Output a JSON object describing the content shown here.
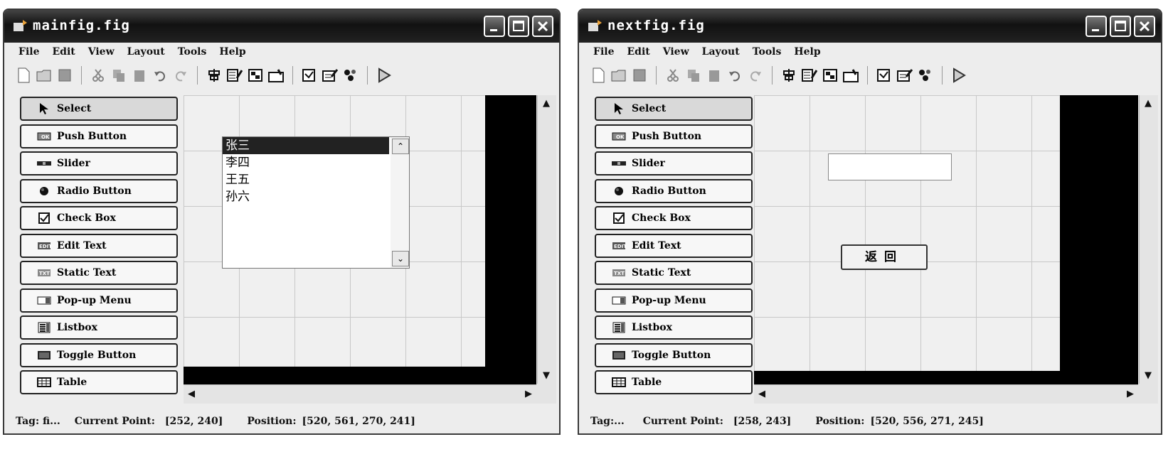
{
  "menu": [
    "File",
    "Edit",
    "View",
    "Layout",
    "Tools",
    "Help"
  ],
  "palette": [
    {
      "label": "Select",
      "icon": "pointer-arrow-icon"
    },
    {
      "label": "Push Button",
      "icon": "push-button-icon"
    },
    {
      "label": "Slider",
      "icon": "slider-icon"
    },
    {
      "label": "Radio Button",
      "icon": "radio-button-icon"
    },
    {
      "label": "Check Box",
      "icon": "check-box-icon"
    },
    {
      "label": "Edit Text",
      "icon": "edit-text-icon"
    },
    {
      "label": "Static Text",
      "icon": "static-text-icon"
    },
    {
      "label": "Pop-up Menu",
      "icon": "popup-menu-icon"
    },
    {
      "label": "Listbox",
      "icon": "listbox-icon"
    },
    {
      "label": "Toggle Button",
      "icon": "toggle-button-icon"
    },
    {
      "label": "Table",
      "icon": "table-icon"
    }
  ],
  "windows": [
    {
      "title": "mainfig.fig",
      "listbox_items": [
        "张三",
        "李四",
        "王五",
        "孙六"
      ],
      "status": {
        "tag": "Tag: fi...",
        "current_point_label": "Current Point:",
        "current_point": "[252, 240]",
        "position_label": "Position:",
        "position": "[520, 561, 270, 241]"
      }
    },
    {
      "title": "nextfig.fig",
      "button_label": "返回",
      "status": {
        "tag": "Tag:...",
        "current_point_label": "Current Point:",
        "current_point": "[258, 243]",
        "position_label": "Position:",
        "position": "[520, 556, 271, 245]"
      }
    }
  ]
}
